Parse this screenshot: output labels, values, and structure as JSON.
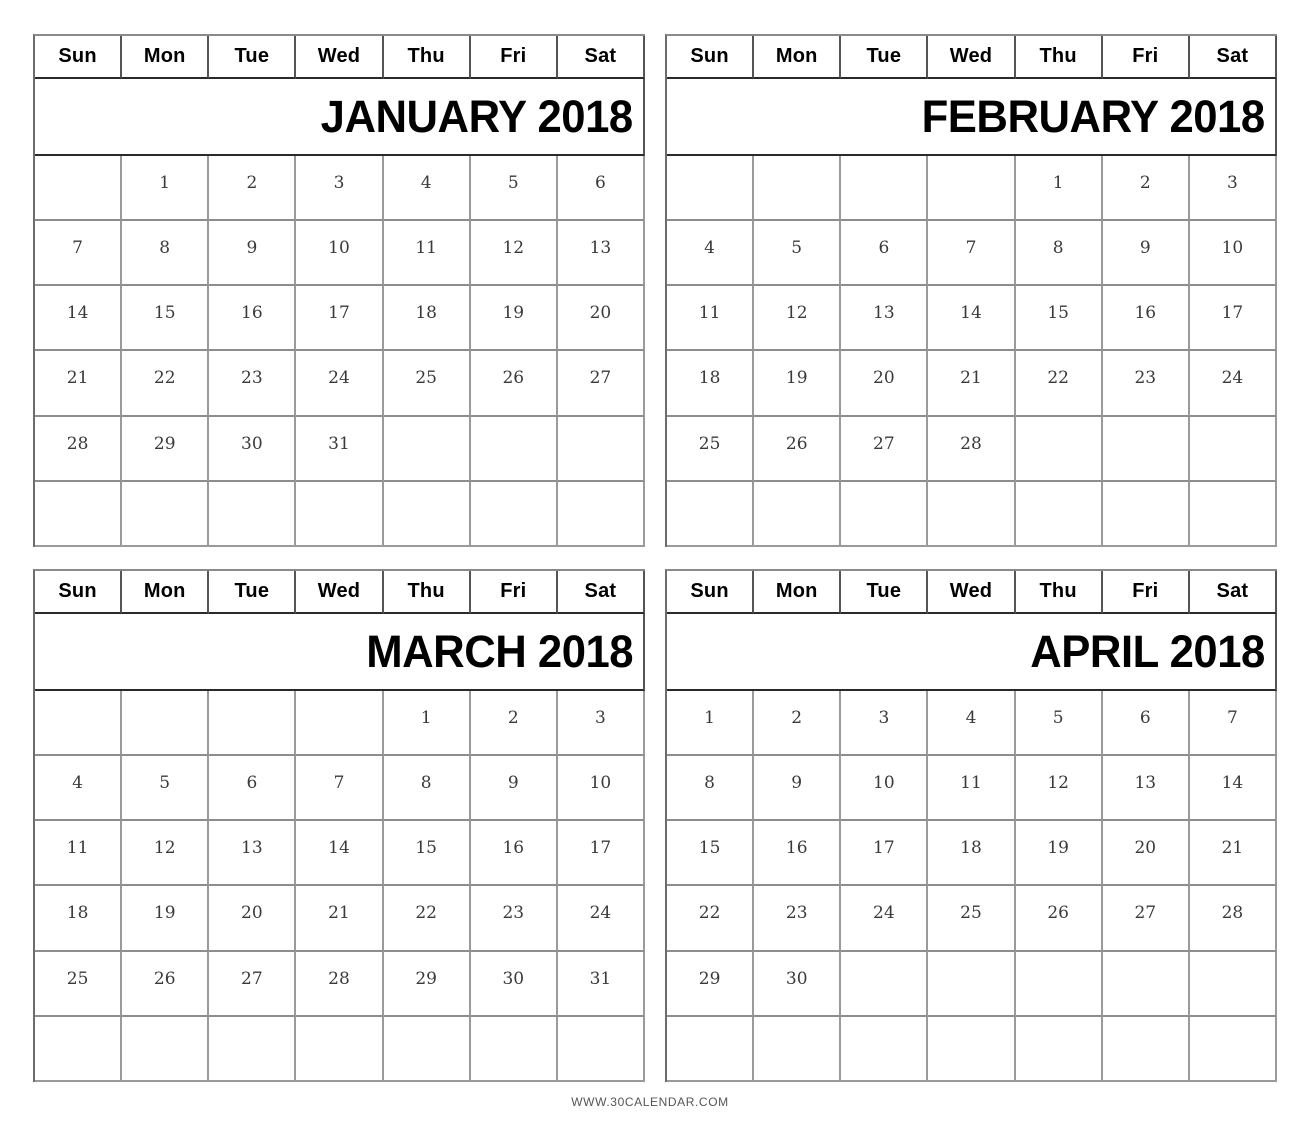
{
  "footer": {
    "site": "WWW.30CALENDAR.COM"
  },
  "weekdays": [
    "Sun",
    "Mon",
    "Tue",
    "Wed",
    "Thu",
    "Fri",
    "Sat"
  ],
  "year": "2018",
  "months": [
    {
      "title": "JANUARY 2018",
      "name": "January",
      "weeks": [
        [
          "",
          "1",
          "2",
          "3",
          "4",
          "5",
          "6"
        ],
        [
          "7",
          "8",
          "9",
          "10",
          "11",
          "12",
          "13"
        ],
        [
          "14",
          "15",
          "16",
          "17",
          "18",
          "19",
          "20"
        ],
        [
          "21",
          "22",
          "23",
          "24",
          "25",
          "26",
          "27"
        ],
        [
          "28",
          "29",
          "30",
          "31",
          "",
          "",
          ""
        ],
        [
          "",
          "",
          "",
          "",
          "",
          "",
          ""
        ]
      ]
    },
    {
      "title": "FEBRUARY 2018",
      "name": "February",
      "weeks": [
        [
          "",
          "",
          "",
          "",
          "1",
          "2",
          "3"
        ],
        [
          "4",
          "5",
          "6",
          "7",
          "8",
          "9",
          "10"
        ],
        [
          "11",
          "12",
          "13",
          "14",
          "15",
          "16",
          "17"
        ],
        [
          "18",
          "19",
          "20",
          "21",
          "22",
          "23",
          "24"
        ],
        [
          "25",
          "26",
          "27",
          "28",
          "",
          "",
          ""
        ],
        [
          "",
          "",
          "",
          "",
          "",
          "",
          ""
        ]
      ]
    },
    {
      "title": "MARCH 2018",
      "name": "March",
      "weeks": [
        [
          "",
          "",
          "",
          "",
          "1",
          "2",
          "3"
        ],
        [
          "4",
          "5",
          "6",
          "7",
          "8",
          "9",
          "10"
        ],
        [
          "11",
          "12",
          "13",
          "14",
          "15",
          "16",
          "17"
        ],
        [
          "18",
          "19",
          "20",
          "21",
          "22",
          "23",
          "24"
        ],
        [
          "25",
          "26",
          "27",
          "28",
          "29",
          "30",
          "31"
        ],
        [
          "",
          "",
          "",
          "",
          "",
          "",
          ""
        ]
      ]
    },
    {
      "title": "APRIL 2018",
      "name": "April",
      "weeks": [
        [
          "1",
          "2",
          "3",
          "4",
          "5",
          "6",
          "7"
        ],
        [
          "8",
          "9",
          "10",
          "11",
          "12",
          "13",
          "14"
        ],
        [
          "15",
          "16",
          "17",
          "18",
          "19",
          "20",
          "21"
        ],
        [
          "22",
          "23",
          "24",
          "25",
          "26",
          "27",
          "28"
        ],
        [
          "29",
          "30",
          "",
          "",
          "",
          "",
          ""
        ],
        [
          "",
          "",
          "",
          "",
          "",
          "",
          ""
        ]
      ]
    }
  ]
}
